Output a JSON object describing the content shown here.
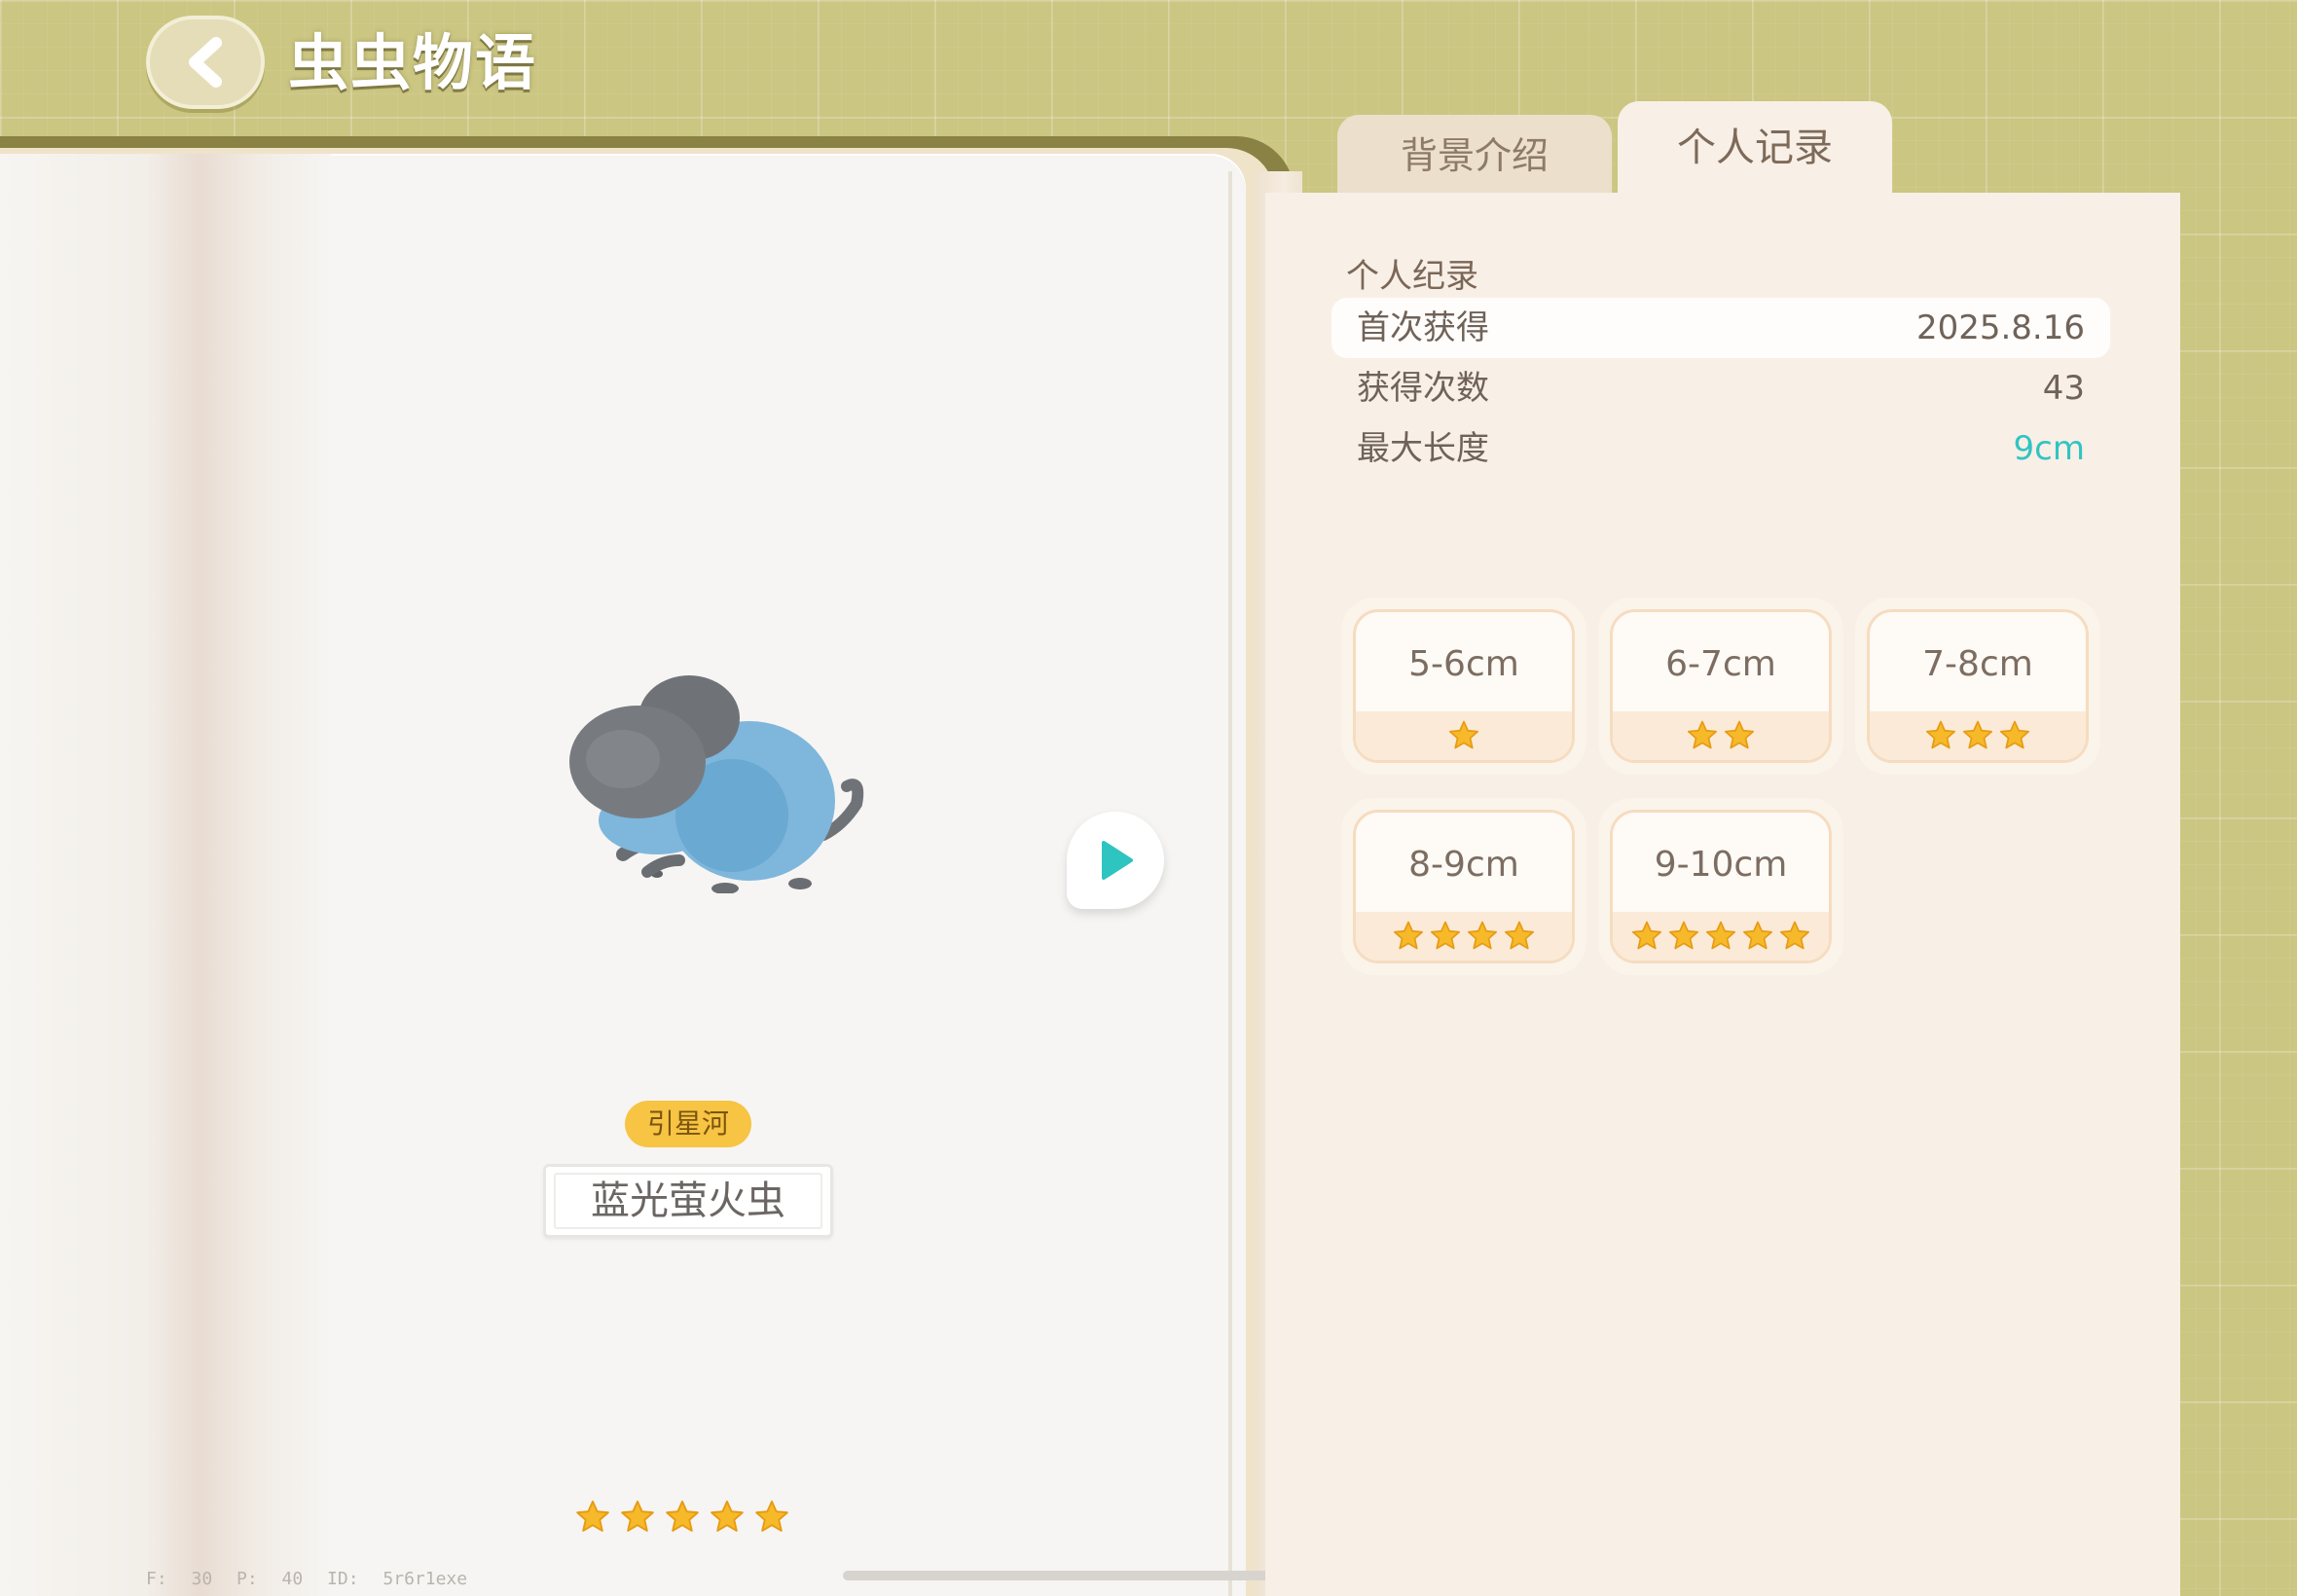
{
  "header": {
    "title": "虫虫物语",
    "back_icon": "chevron-left-icon"
  },
  "tabs": [
    {
      "label": "背景介绍",
      "active": false
    },
    {
      "label": "个人记录",
      "active": true
    }
  ],
  "insect": {
    "location": "引星河",
    "name": "蓝光萤火虫",
    "rarity_stars": 5,
    "colors": {
      "body": "#7fb6dc",
      "wing": "#6f7378"
    }
  },
  "record": {
    "section_title": "个人纪录",
    "rows": [
      {
        "label": "首次获得",
        "value": "2025.8.16",
        "highlight": true
      },
      {
        "label": "获得次数",
        "value": "43",
        "highlight": false
      },
      {
        "label": "最大长度",
        "value": "9cm",
        "highlight": false,
        "accent": "#31c4c2"
      }
    ]
  },
  "size_tiers": [
    {
      "label": "5-6cm",
      "stars": 1
    },
    {
      "label": "6-7cm",
      "stars": 2
    },
    {
      "label": "7-8cm",
      "stars": 3
    },
    {
      "label": "8-9cm",
      "stars": 4
    },
    {
      "label": "9-10cm",
      "stars": 5
    }
  ],
  "debug": {
    "text": "F: 30   P: 40   ID: 5r6r1exe"
  },
  "colors": {
    "star": "#f6b92a",
    "play": "#2ec4c0",
    "background": "#cbc682"
  }
}
